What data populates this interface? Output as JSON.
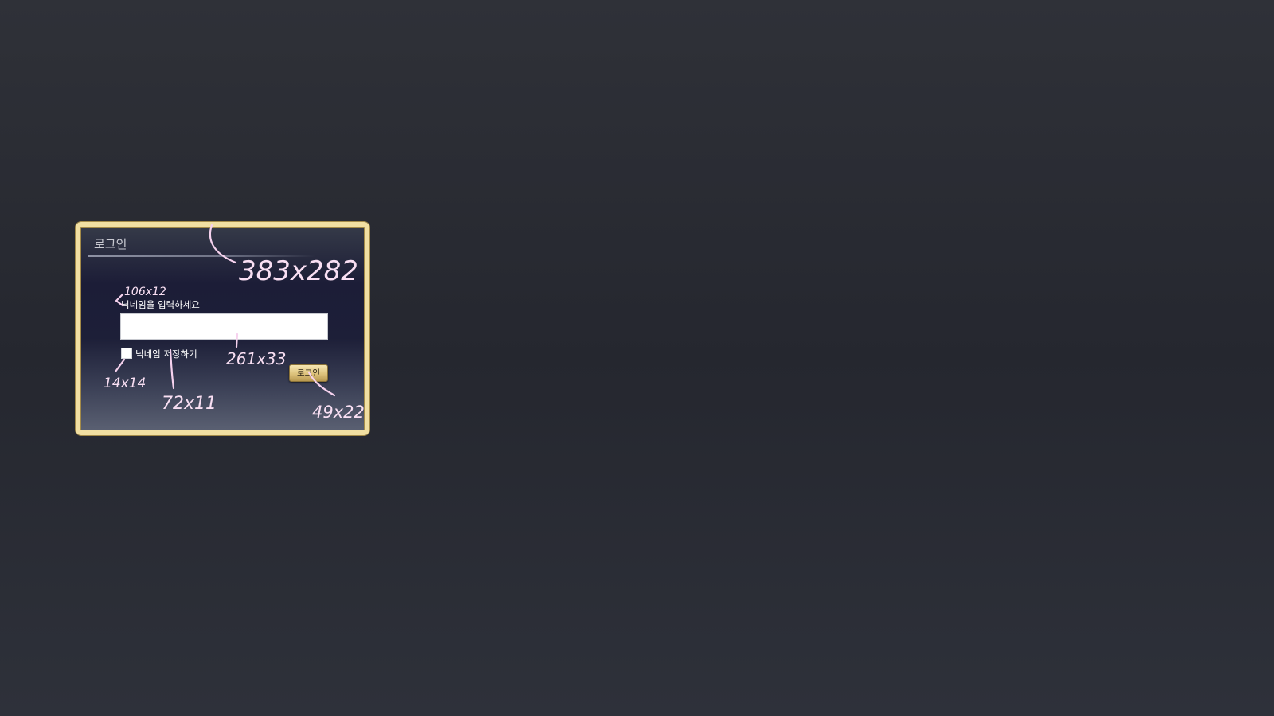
{
  "dialog": {
    "title": "로그인",
    "prompt": "닉네임을 입력하세요",
    "nickname": {
      "value": "",
      "placeholder": ""
    },
    "remember": {
      "label": "닉네임 저장하기",
      "checked": false
    },
    "login_button": "로그인"
  },
  "annotations": {
    "dialog_size": "383x282",
    "prompt_size": "106x12",
    "input_size": "261x33",
    "checkbox_size": "14x14",
    "label_size": "72x11",
    "button_size": "49x22"
  },
  "colors": {
    "frame_gold": "#f1dfa2",
    "panel_navy": "#1c1d37",
    "annotation_pink": "#f6d2ee",
    "button_gold": "#ddc27c"
  }
}
